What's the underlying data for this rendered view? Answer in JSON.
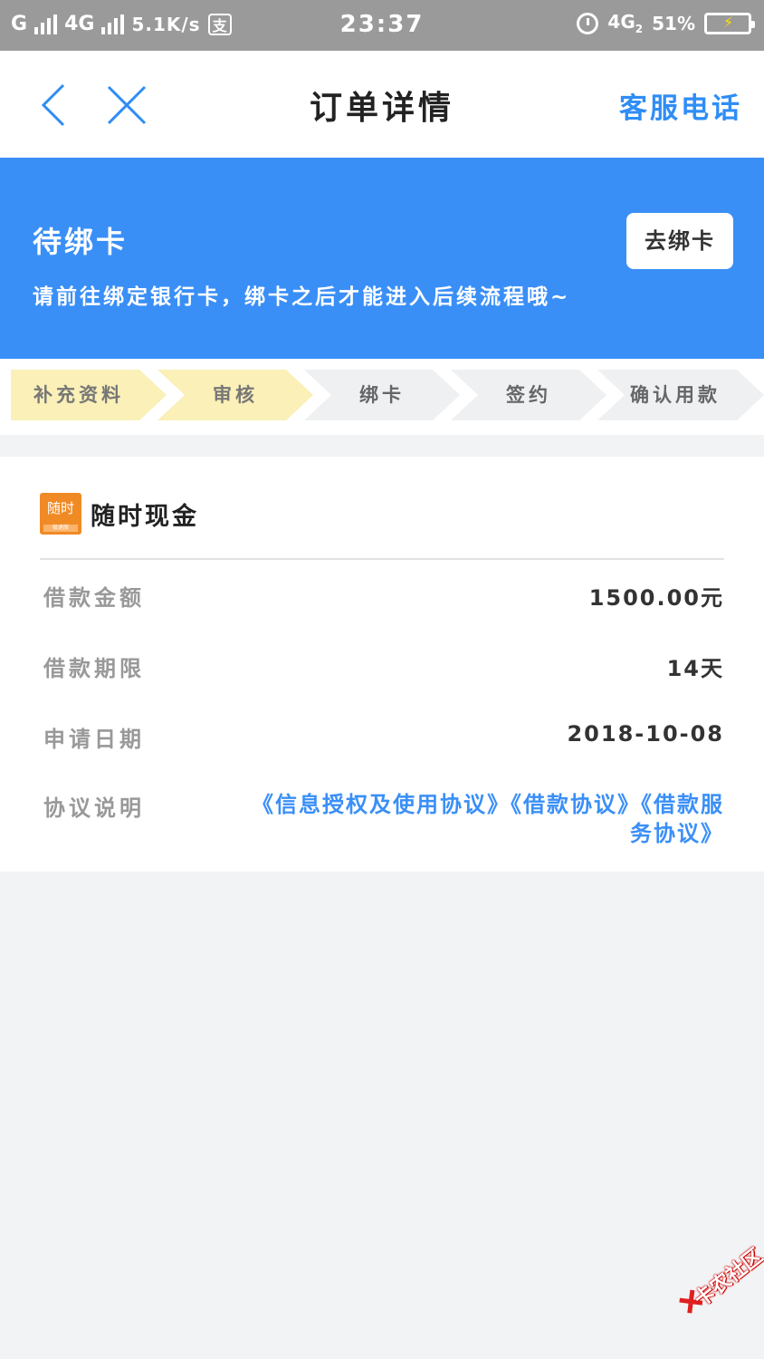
{
  "status_bar": {
    "carrier1": "G",
    "carrier2": "4G",
    "net_speed": "5.1K/s",
    "pay_icon": "支",
    "time": "23:37",
    "network": "4G",
    "sim": "2",
    "battery": "51%",
    "battery_level": 0.96,
    "icons": [
      "signal-icon",
      "alipay-icon",
      "alarm-icon",
      "battery-icon"
    ]
  },
  "nav": {
    "title": "订单详情",
    "service_label": "客服电话",
    "icons": [
      "back-chevron-icon",
      "close-icon"
    ]
  },
  "banner": {
    "title": "待绑卡",
    "description": "请前往绑定银行卡，绑卡之后才能进入后续流程哦~",
    "button_label": "去绑卡",
    "color": "#3a8ff7"
  },
  "steps": [
    {
      "label": "补充资料",
      "state": "done"
    },
    {
      "label": "审核",
      "state": "current"
    },
    {
      "label": "绑卡",
      "state": "pending"
    },
    {
      "label": "签约",
      "state": "pending"
    },
    {
      "label": "确认用款",
      "state": "pending"
    }
  ],
  "order": {
    "product_name": "随时现金",
    "logo_text": "随时",
    "logo_subtext": "极速版",
    "rows": [
      {
        "label": "借款金额",
        "value": "1500.00元"
      },
      {
        "label": "借款期限",
        "value": "14天"
      },
      {
        "label": "申请日期",
        "value": "2018-10-08"
      }
    ],
    "agreement_label": "协议说明",
    "agreements": [
      "《信息授权及使用协议》",
      "《借款协议》",
      "《借款服务协议》"
    ]
  },
  "watermark": {
    "text": "卡农社区"
  },
  "colors": {
    "accent": "#3a8ff7",
    "step_active": "#faf0b8",
    "step_pending": "#eef0f2",
    "page_bg": "#f2f3f4"
  }
}
